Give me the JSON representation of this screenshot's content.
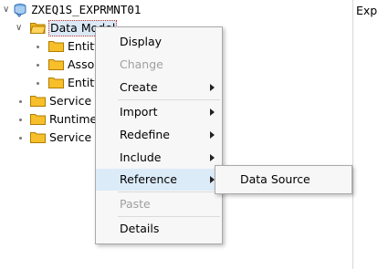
{
  "tree": {
    "root": {
      "label": "ZXEQ1S_EXPRMNT01",
      "icon": "service-icon"
    },
    "data_model": {
      "label": "Data Model",
      "children": [
        "Entity",
        "Asso",
        "Entity"
      ]
    },
    "nodes": [
      "Service I",
      "Runtime",
      "Service I"
    ]
  },
  "right_pane": {
    "text": "Expe"
  },
  "context_menu": {
    "items": [
      {
        "label": "Display",
        "disabled": false,
        "submenu": false
      },
      {
        "label": "Change",
        "disabled": true,
        "submenu": false
      },
      {
        "label": "Create",
        "disabled": false,
        "submenu": true
      },
      {
        "label": "Import",
        "disabled": false,
        "submenu": true
      },
      {
        "label": "Redefine",
        "disabled": false,
        "submenu": true
      },
      {
        "label": "Include",
        "disabled": false,
        "submenu": true
      },
      {
        "label": "Reference",
        "disabled": false,
        "submenu": true
      },
      {
        "label": "Paste",
        "disabled": true,
        "submenu": false
      },
      {
        "label": "Details",
        "disabled": false,
        "submenu": false
      }
    ],
    "submenu_reference": [
      "Data Source"
    ]
  },
  "colors": {
    "folder": "#f2b41b",
    "menu_bg": "#f7f7f7",
    "hover": "#dcebf8",
    "selected_border": "#c0392b"
  }
}
